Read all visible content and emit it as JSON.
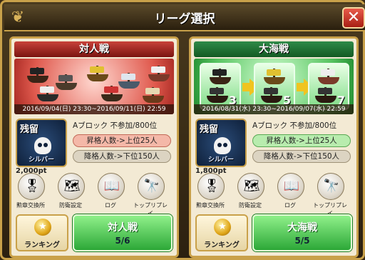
{
  "window": {
    "title": "リーグ選択",
    "close_label": "✕"
  },
  "panels": [
    {
      "mode": "対人戦",
      "period": "2016/09/04(日) 23:30~2016/09/11(日) 22:59",
      "rank": {
        "label": "残留",
        "tier": "シルバー"
      },
      "block": "Aブロック  不参加/800位",
      "promotion": "昇格人数->上位25人",
      "demotion": "降格人数->下位150人",
      "points": "2,000pt",
      "actions": [
        "勲章交換所",
        "防衛設定",
        "ログ",
        "トップリプレイ"
      ],
      "ranking_label": "ランキング",
      "play": {
        "label": "対人戦",
        "count": "5/6"
      }
    },
    {
      "mode": "大海戦",
      "period": "2016/08/31(水) 23:30~2016/09/07(水) 22:59",
      "rank": {
        "label": "残留",
        "tier": "シルバー"
      },
      "block": "Aブロック  不参加/800位",
      "promotion": "昇格人数->上位25人",
      "demotion": "降格人数->下位150人",
      "points": "1,800pt",
      "fleet_sizes": [
        "3",
        "5",
        "7"
      ],
      "actions": [
        "勲章交換所",
        "防衛設定",
        "ログ",
        "トップリプレイ"
      ],
      "ranking_label": "ランキング",
      "play": {
        "label": "大海戦",
        "count": "5/5"
      }
    }
  ]
}
